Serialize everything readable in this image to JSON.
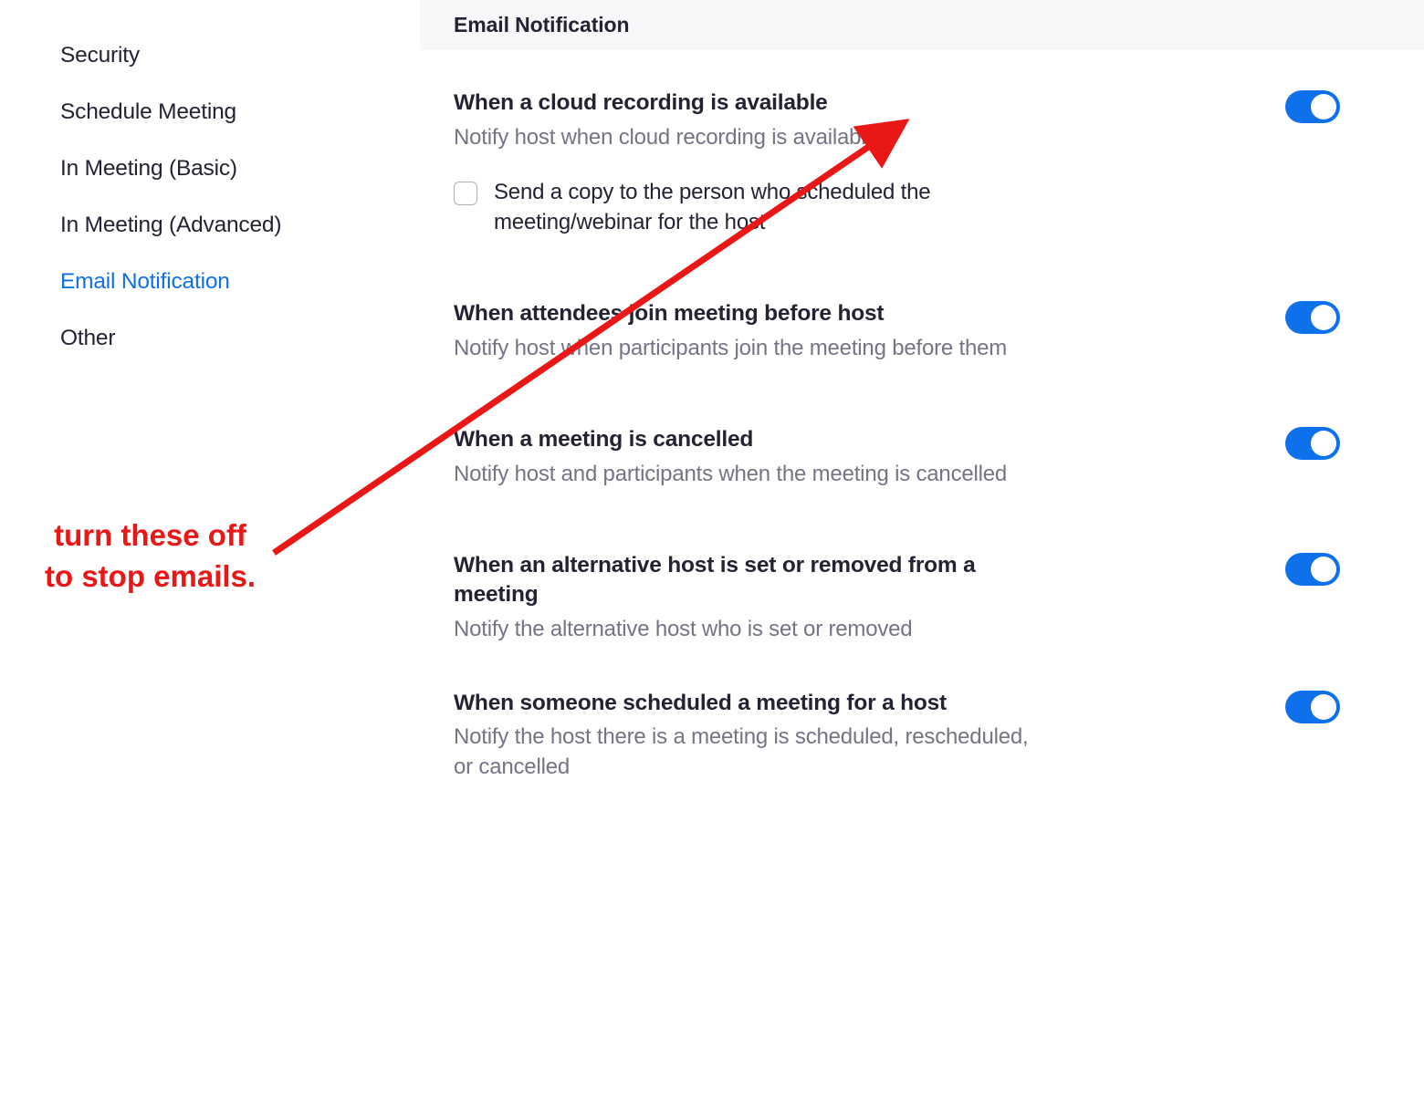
{
  "sidebar": {
    "items": [
      {
        "label": "Security"
      },
      {
        "label": "Schedule Meeting"
      },
      {
        "label": "In Meeting (Basic)"
      },
      {
        "label": "In Meeting (Advanced)"
      },
      {
        "label": "Email Notification"
      },
      {
        "label": "Other"
      }
    ],
    "active_index": 4
  },
  "section": {
    "header": "Email Notification"
  },
  "settings": [
    {
      "title": "When a cloud recording is available",
      "desc": "Notify host when cloud recording is available",
      "toggle_on": true,
      "checkbox": {
        "label": "Send a copy to the person who scheduled the meeting/webinar for the host",
        "checked": false
      }
    },
    {
      "title": "When attendees join meeting before host",
      "desc": "Notify host when participants join the meeting before them",
      "toggle_on": true
    },
    {
      "title": "When a meeting is cancelled",
      "desc": "Notify host and participants when the meeting is cancelled",
      "toggle_on": true
    },
    {
      "title": "When an alternative host is set or removed from a meeting",
      "desc": "Notify the alternative host who is set or removed",
      "toggle_on": true
    },
    {
      "title": "When someone scheduled a meeting for a host",
      "desc": "Notify the host there is a meeting is scheduled, rescheduled, or cancelled",
      "toggle_on": true
    }
  ],
  "annotation": {
    "line1": "turn these off",
    "line2": "to stop emails."
  }
}
